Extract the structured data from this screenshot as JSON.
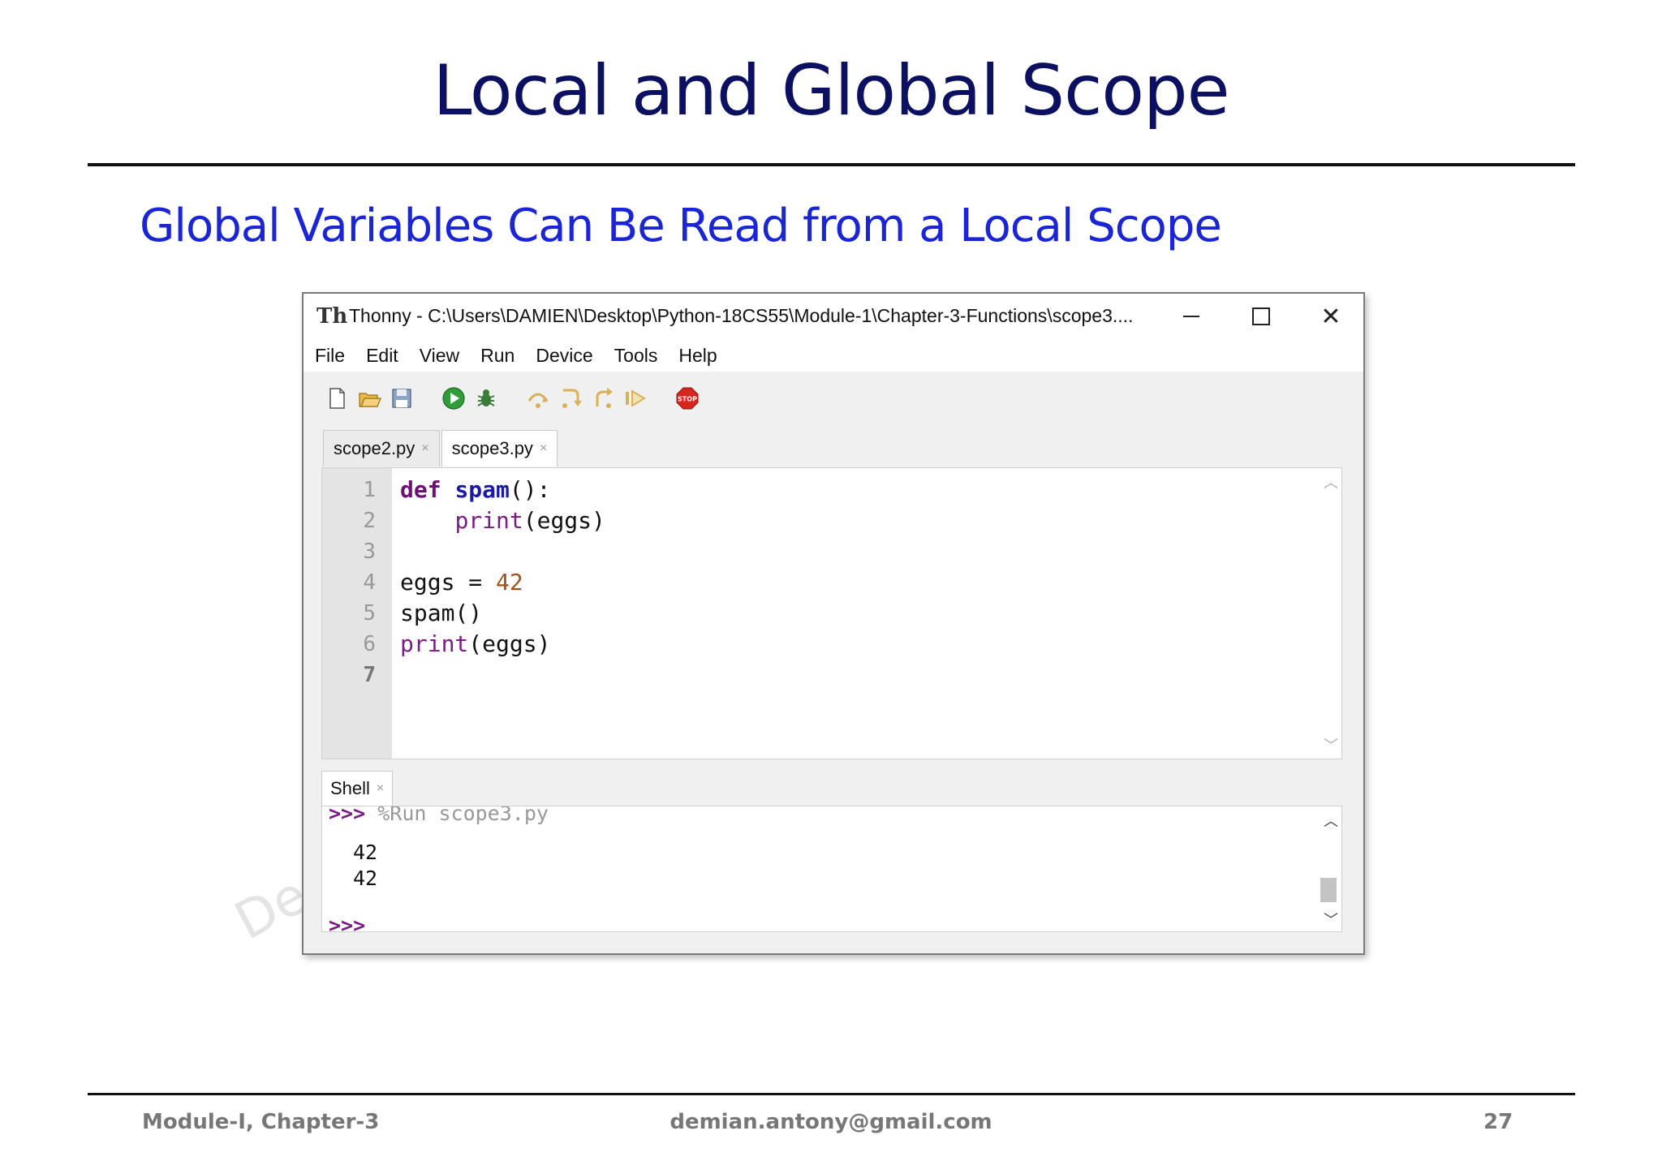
{
  "slide": {
    "title": "Local and Global Scope",
    "subtitle": "Global Variables Can Be Read from a Local Scope",
    "watermark": "De"
  },
  "window": {
    "app_name": "Thonny",
    "title": "Thonny  -  C:\\Users\\DAMIEN\\Desktop\\Python-18CS55\\Module-1\\Chapter-3-Functions\\scope3....",
    "menu": [
      "File",
      "Edit",
      "View",
      "Run",
      "Device",
      "Tools",
      "Help"
    ],
    "toolbar_icons": [
      "new-file-icon",
      "open-file-icon",
      "save-icon",
      "run-icon",
      "debug-icon",
      "step-over-icon",
      "step-into-icon",
      "step-out-icon",
      "resume-icon",
      "stop-icon"
    ],
    "tabs": [
      {
        "label": "scope2.py",
        "close": "×"
      },
      {
        "label": "scope3.py",
        "close": "×"
      }
    ],
    "editor": {
      "line_numbers": [
        "1",
        "2",
        "3",
        "4",
        "5",
        "6",
        "7"
      ],
      "code": [
        "def spam():",
        "    print(eggs)",
        "",
        "eggs = 42",
        "spam()",
        "print(eggs)",
        ""
      ]
    },
    "shell": {
      "tab_label": "Shell",
      "tab_close": "×",
      "prompt": ">>>",
      "command": "%Run scope3.py",
      "output": [
        "42",
        "42"
      ],
      "next_prompt": ">>>"
    }
  },
  "footer": {
    "left": "Module-I, Chapter-3",
    "center": "demian.antony@gmail.com",
    "right": "27"
  }
}
